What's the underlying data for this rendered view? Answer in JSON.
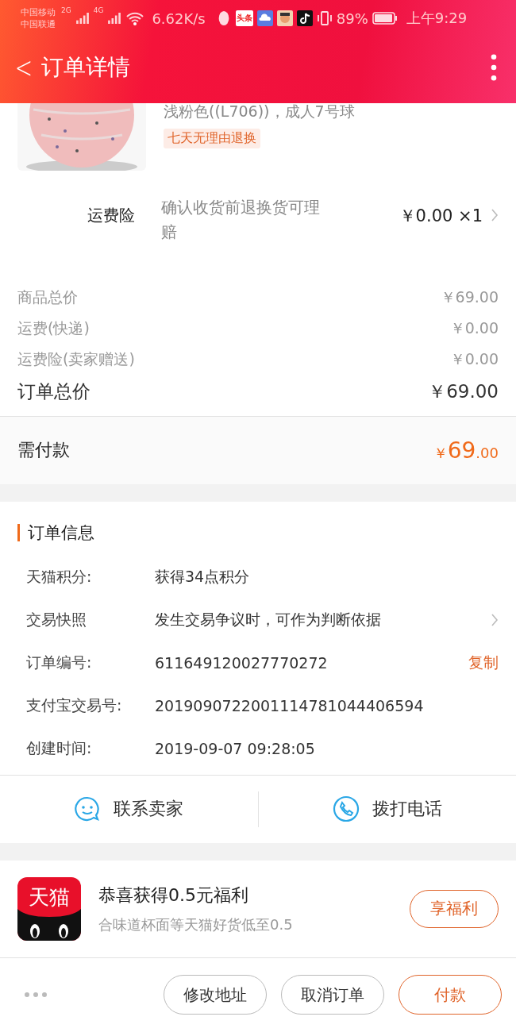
{
  "status_bar": {
    "carriers": [
      "中国移动",
      "中国联通"
    ],
    "networks": [
      "2G",
      "4G"
    ],
    "speed": "6.62K/s",
    "news_app": "头条",
    "battery": "89%",
    "time": "上午9:29"
  },
  "header": {
    "back": "<",
    "title": "订单详情"
  },
  "product": {
    "kind": "picture",
    "variant": "浅粉色((L706))，成人7号球",
    "tag": "七天无理由退换"
  },
  "insurance": {
    "label": "运费险",
    "description": "确认收货前退换货可理赔",
    "price": "￥0.00 ×1"
  },
  "prices": [
    {
      "label": "商品总价",
      "value": "￥69.00"
    },
    {
      "label": "运费(快递)",
      "value": "￥0.00"
    },
    {
      "label": "运费险(卖家赠送)",
      "value": "￥0.00"
    }
  ],
  "total": {
    "label": "订单总价",
    "value": "￥69.00"
  },
  "payment": {
    "label": "需付款",
    "currency": "￥",
    "integer": "69",
    "decimal": ".00"
  },
  "order_info": {
    "title": "订单信息",
    "rows": [
      {
        "label": "天猫积分:",
        "value": "获得34点积分",
        "kind": "plain"
      },
      {
        "label": "交易快照",
        "value": "发生交易争议时，可作为判断依据",
        "kind": "link"
      },
      {
        "label": "订单编号:",
        "value": "611649120027770272",
        "kind": "copy",
        "action": "复制"
      },
      {
        "label": "支付宝交易号:",
        "value": "2019090722001114781044406594",
        "kind": "plain"
      },
      {
        "label": "创建时间:",
        "value": "2019-09-07 09:28:05",
        "kind": "plain"
      }
    ]
  },
  "contacts": [
    {
      "label": "联系卖家",
      "kind": "chat"
    },
    {
      "label": "拨打电话",
      "kind": "phone"
    }
  ],
  "promo": {
    "logo": "天猫",
    "title": "恭喜获得0.5元福利",
    "subtitle": "合味道杯面等天猫好货低至0.5",
    "button": "享福利"
  },
  "actions": [
    {
      "label": "修改地址",
      "primary": false
    },
    {
      "label": "取消订单",
      "primary": false
    },
    {
      "label": "付款",
      "primary": true
    }
  ]
}
